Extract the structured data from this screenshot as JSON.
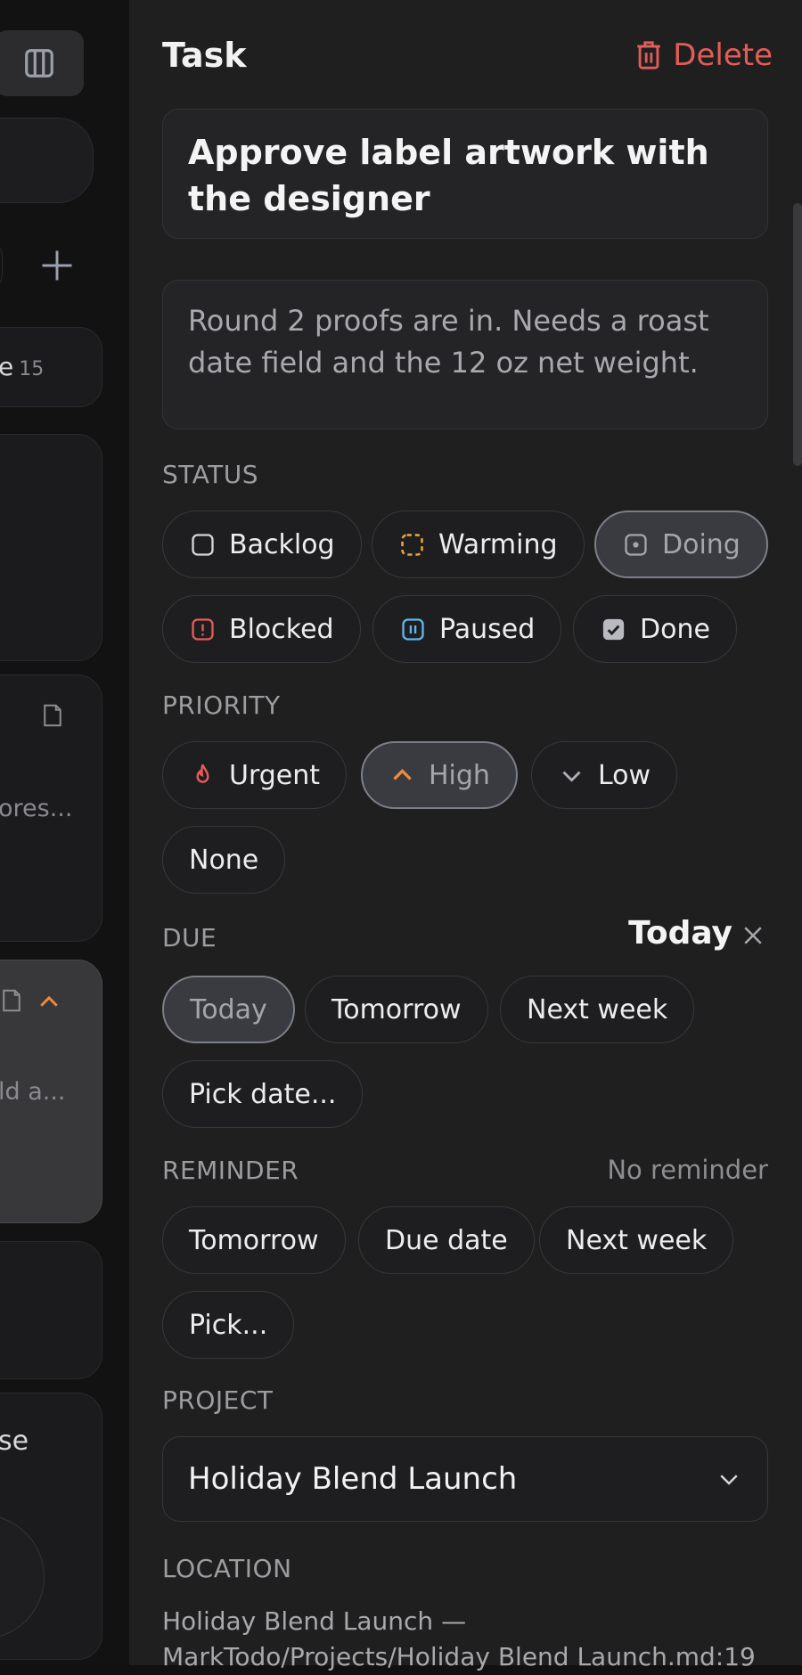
{
  "left_pane": {
    "count_label_fragment": "e",
    "count_value": "15",
    "card_text_1": "ores...",
    "card_text_2": "ld a...",
    "card_text_3": "se"
  },
  "header": {
    "title": "Task",
    "delete_label": "Delete"
  },
  "task": {
    "title": "Approve label artwork with the designer",
    "notes": "Round 2 proofs are in. Needs a roast date field and the 12 oz net weight."
  },
  "status": {
    "label": "STATUS",
    "options": [
      "Backlog",
      "Warming",
      "Doing",
      "Blocked",
      "Paused",
      "Done"
    ],
    "selected": "Doing"
  },
  "priority": {
    "label": "PRIORITY",
    "options": [
      "Urgent",
      "High",
      "Low",
      "None"
    ],
    "selected": "High"
  },
  "due": {
    "label": "DUE",
    "value": "Today",
    "options": [
      "Today",
      "Tomorrow",
      "Next week",
      "Pick date..."
    ],
    "selected": "Today"
  },
  "reminder": {
    "label": "REMINDER",
    "status": "No reminder",
    "options": [
      "Tomorrow",
      "Due date",
      "Next week",
      "Pick..."
    ]
  },
  "project": {
    "label": "PROJECT",
    "value": "Holiday Blend Launch"
  },
  "location": {
    "label": "LOCATION",
    "value": "Holiday Blend Launch — MarkTodo/Projects/Holiday Blend Launch.md:19"
  },
  "colors": {
    "accent_red": "#e35d58",
    "warming": "#e8a43a",
    "paused": "#5fb8e8",
    "priority_orange": "#f08a3c"
  }
}
